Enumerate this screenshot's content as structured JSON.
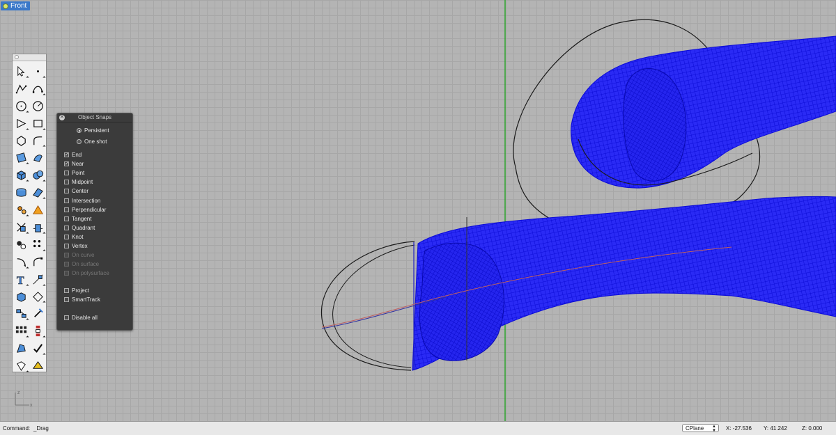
{
  "viewport": {
    "name": "Front",
    "grid_axis_color": "#1aa21a",
    "surface_color": "#1d1df2"
  },
  "toolbar": {
    "tools": [
      "select-arrow-icon",
      "point-icon",
      "polyline-icon",
      "curve-icon",
      "circle-icon",
      "arc-icon",
      "ellipse-icon",
      "rectangle-icon",
      "polygon-icon",
      "fillet-curve-icon",
      "surface-from-points-icon",
      "loft-icon",
      "box-icon",
      "sphere-icon",
      "extrude-icon",
      "planar-surface-icon",
      "explode-icon",
      "boolean-icon",
      "trim-icon",
      "split-icon",
      "group-icon",
      "array-icon",
      "fillet-icon",
      "blend-curve-icon",
      "text-icon",
      "dimension-icon",
      "block-icon",
      "analyze-icon",
      "layers-icon",
      "properties-icon",
      "grid-icon",
      "snap-icon",
      "render-icon",
      "check-icon",
      "shade-icon",
      "material-icon"
    ]
  },
  "object_snaps": {
    "title": "Object Snaps",
    "modes": [
      {
        "label": "Persistent",
        "selected": true
      },
      {
        "label": "One shot",
        "selected": false
      }
    ],
    "snaps": [
      {
        "label": "End",
        "checked": true,
        "enabled": true
      },
      {
        "label": "Near",
        "checked": true,
        "enabled": true
      },
      {
        "label": "Point",
        "checked": false,
        "enabled": true
      },
      {
        "label": "Midpoint",
        "checked": false,
        "enabled": true
      },
      {
        "label": "Center",
        "checked": false,
        "enabled": true
      },
      {
        "label": "Intersection",
        "checked": false,
        "enabled": true
      },
      {
        "label": "Perpendicular",
        "checked": false,
        "enabled": true
      },
      {
        "label": "Tangent",
        "checked": false,
        "enabled": true
      },
      {
        "label": "Quadrant",
        "checked": false,
        "enabled": true
      },
      {
        "label": "Knot",
        "checked": false,
        "enabled": true
      },
      {
        "label": "Vertex",
        "checked": false,
        "enabled": true
      },
      {
        "label": "On curve",
        "checked": false,
        "enabled": false
      },
      {
        "label": "On surface",
        "checked": false,
        "enabled": false
      },
      {
        "label": "On polysurface",
        "checked": false,
        "enabled": false
      }
    ],
    "options": [
      {
        "label": "Project",
        "checked": false
      },
      {
        "label": "SmartTrack",
        "checked": false
      }
    ],
    "disable_all": {
      "label": "Disable all",
      "checked": false
    }
  },
  "axes": {
    "y_label": "z",
    "x_label": "x"
  },
  "status": {
    "command_label": "Command:",
    "command_value": "_Drag",
    "cplane": "CPlane",
    "x": "X:  -27.536",
    "y": "Y:  41.242",
    "z": "Z:  0.000"
  }
}
